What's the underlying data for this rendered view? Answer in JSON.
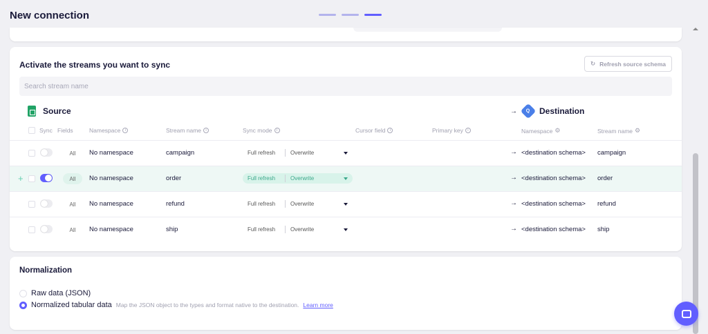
{
  "header": {
    "title": "New connection",
    "steps": 3,
    "active_step": 3
  },
  "streams_card": {
    "title": "Activate the streams you want to sync",
    "refresh_label": "Refresh source schema",
    "search_placeholder": "Search stream name",
    "source_label": "Source",
    "destination_label": "Destination",
    "columns": {
      "sync": "Sync",
      "fields": "Fields",
      "namespace": "Namespace",
      "stream_name": "Stream name",
      "sync_mode": "Sync mode",
      "cursor_field": "Cursor field",
      "primary_key": "Primary key",
      "dest_namespace": "Namespace",
      "dest_stream_name": "Stream name"
    },
    "rows": [
      {
        "enabled": false,
        "fields": "All",
        "namespace": "No namespace",
        "stream": "campaign",
        "mode_sync": "Full refresh",
        "mode_dest": "Overwrite",
        "dest_namespace": "<destination schema>",
        "dest_stream": "campaign"
      },
      {
        "enabled": true,
        "fields": "All",
        "namespace": "No namespace",
        "stream": "order",
        "mode_sync": "Full refresh",
        "mode_dest": "Overwrite",
        "dest_namespace": "<destination schema>",
        "dest_stream": "order"
      },
      {
        "enabled": false,
        "fields": "All",
        "namespace": "No namespace",
        "stream": "refund",
        "mode_sync": "Full refresh",
        "mode_dest": "Overwrite",
        "dest_namespace": "<destination schema>",
        "dest_stream": "refund"
      },
      {
        "enabled": false,
        "fields": "All",
        "namespace": "No namespace",
        "stream": "ship",
        "mode_sync": "Full refresh",
        "mode_dest": "Overwrite",
        "dest_namespace": "<destination schema>",
        "dest_stream": "ship"
      }
    ]
  },
  "normalization": {
    "title": "Normalization",
    "options": [
      {
        "label": "Raw data (JSON)",
        "selected": false
      },
      {
        "label": "Normalized tabular data",
        "selected": true,
        "hint": "Map the JSON object to the types and format native to the destination.",
        "link": "Learn more"
      }
    ]
  },
  "colors": {
    "accent": "#615eff",
    "selected_row": "#eef8f5",
    "mode_active": "#3aa88a"
  }
}
